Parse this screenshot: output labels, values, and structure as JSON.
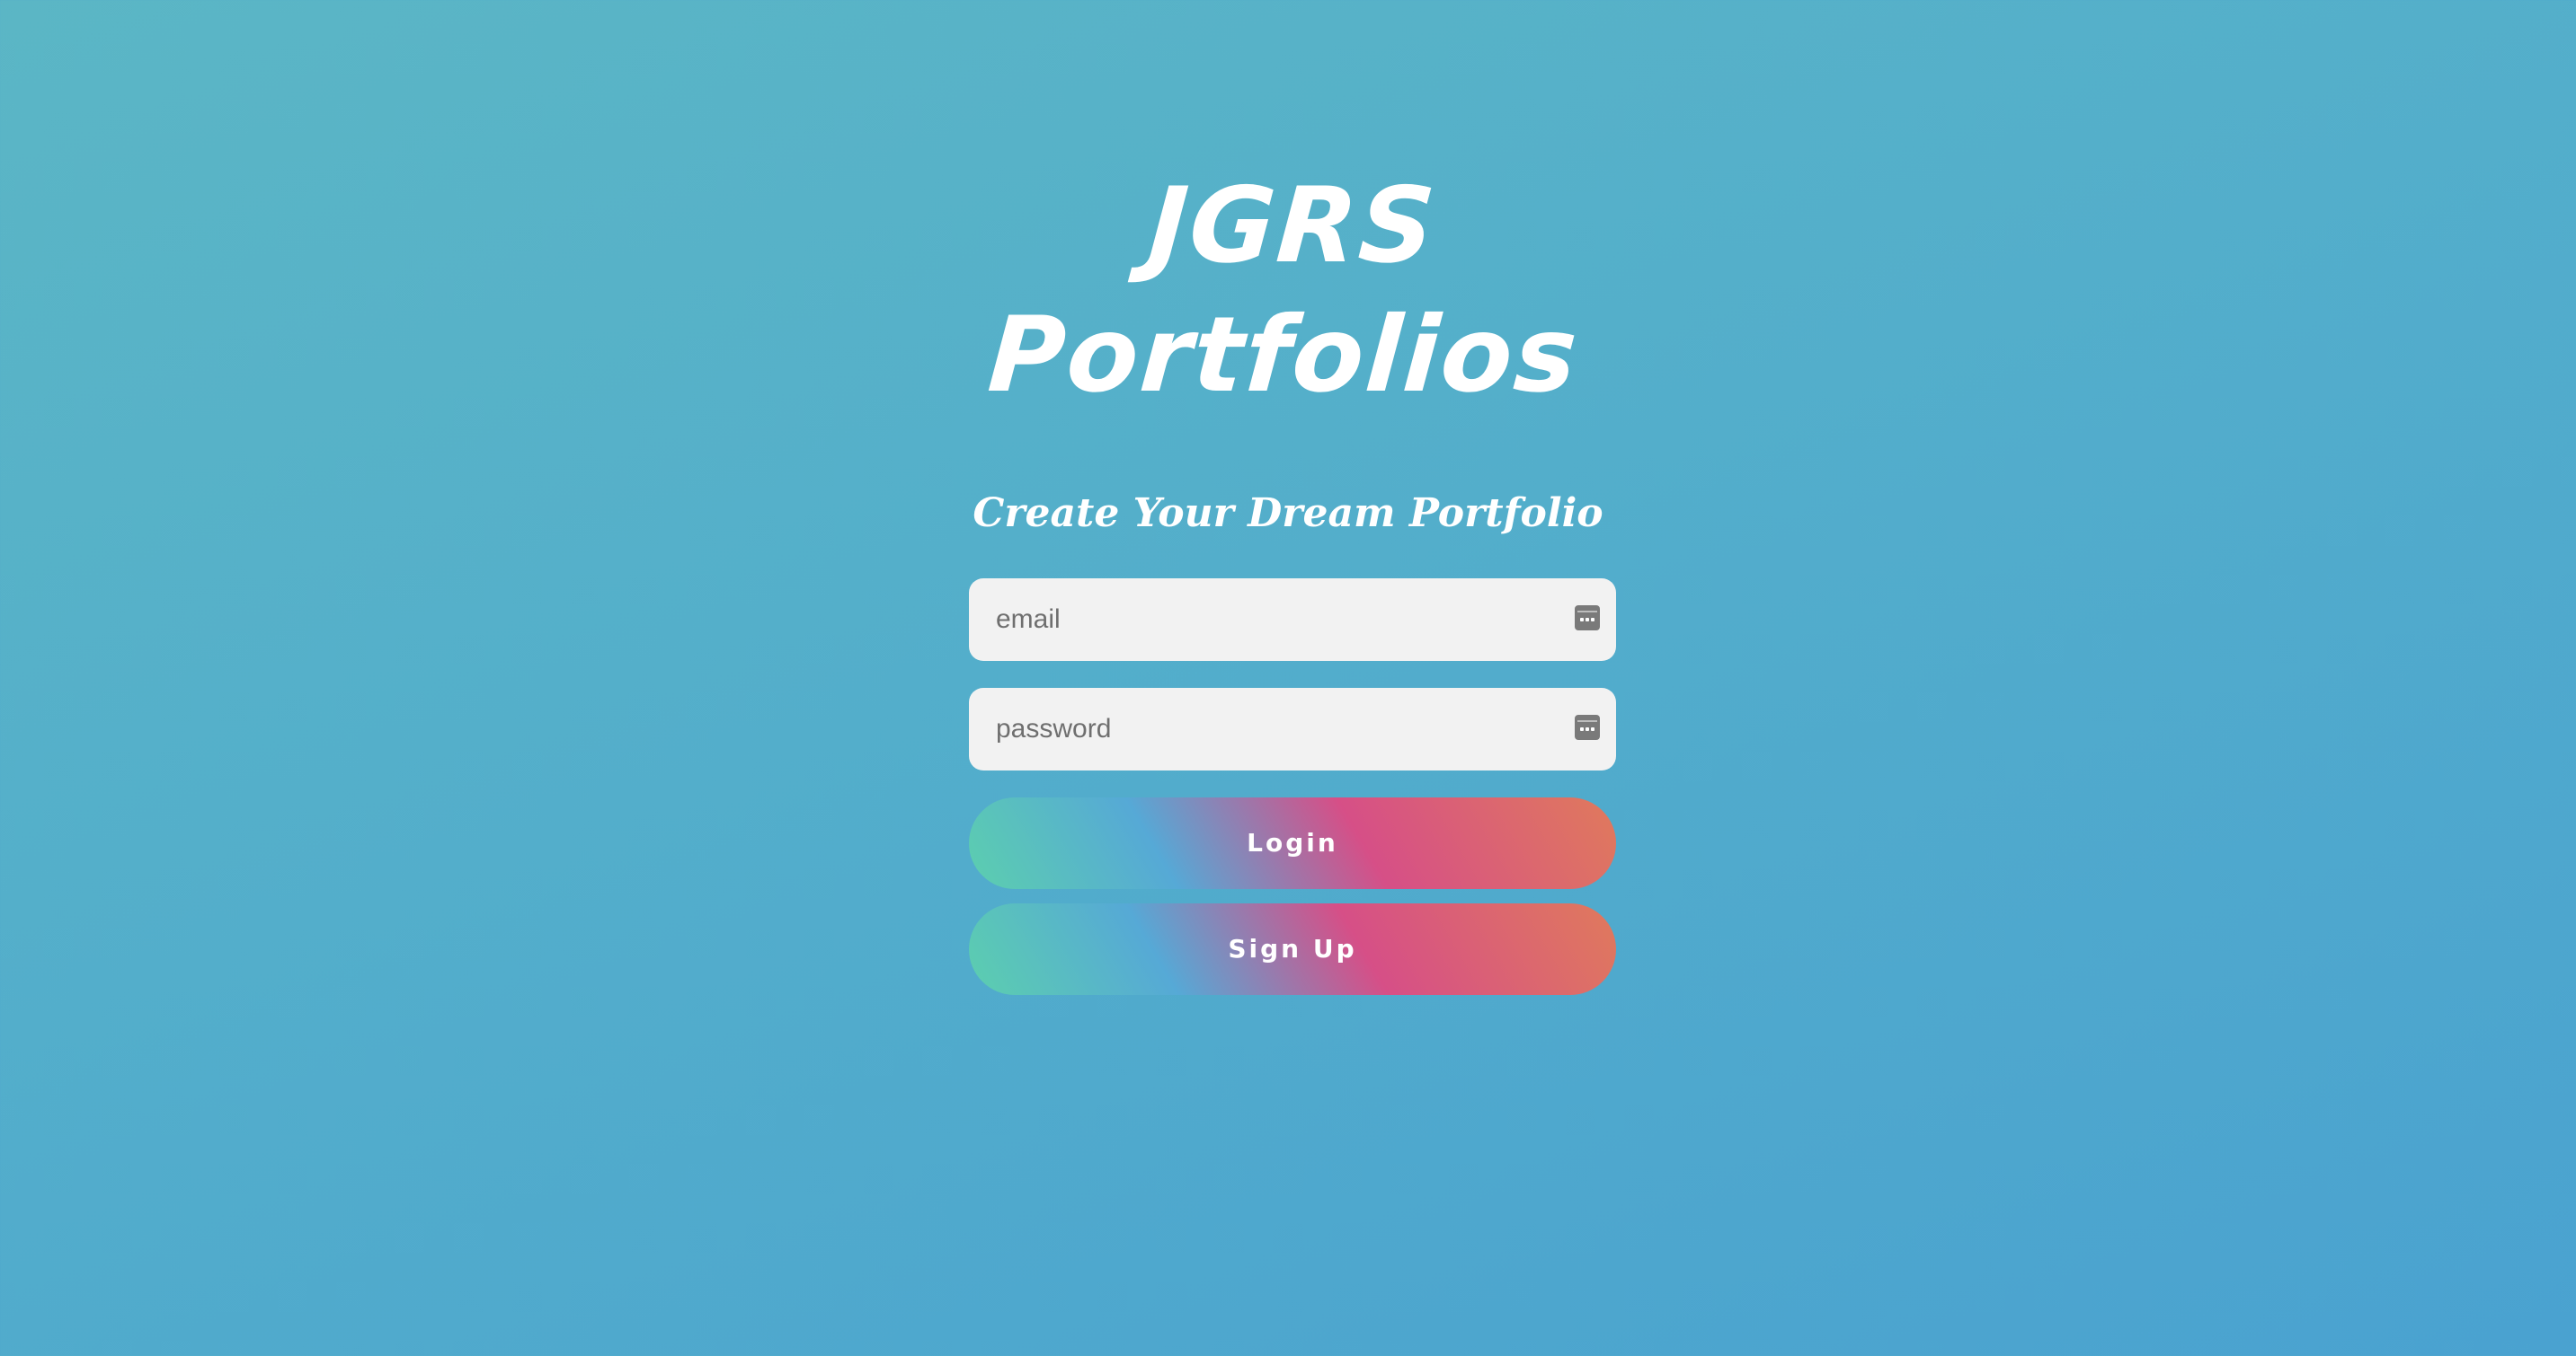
{
  "brand": {
    "line1": "JGRS",
    "line2": "Portfolios"
  },
  "tagline": "Create Your Dream Portfolio",
  "form": {
    "email_placeholder": "email",
    "password_placeholder": "password",
    "field_icon": "password-manager-key-icon"
  },
  "buttons": {
    "login_label": "Login",
    "signup_label": "Sign Up"
  },
  "colors": {
    "background_start": "#5bb6c5",
    "background_end": "#4aa2d0",
    "button_gradient": [
      "#5ccfae",
      "#56a9d6",
      "#d64f87",
      "#e07a5c"
    ],
    "field_background": "#f2f2f2",
    "text_light": "#ffffff"
  }
}
